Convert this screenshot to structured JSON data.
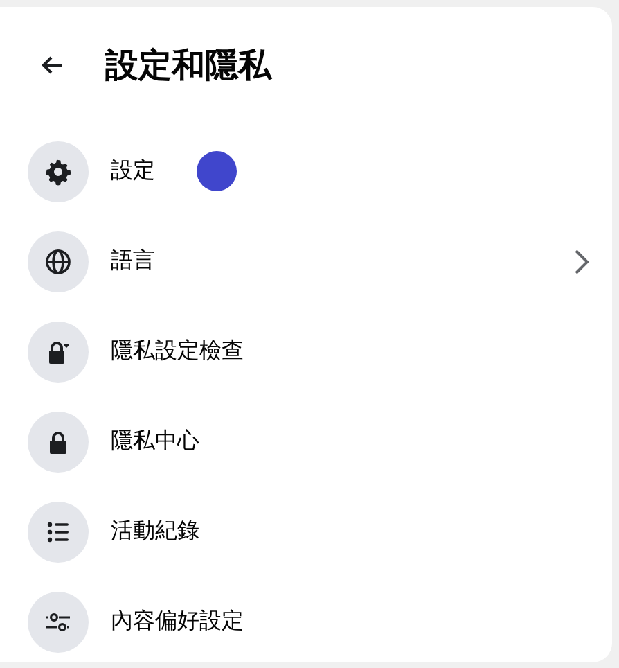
{
  "title": "設定和隱私",
  "items": [
    {
      "label": "設定",
      "submenu": false,
      "pointer": true
    },
    {
      "label": "語言",
      "submenu": true,
      "pointer": false
    },
    {
      "label": "隱私設定檢查",
      "submenu": false,
      "pointer": false
    },
    {
      "label": "隱私中心",
      "submenu": false,
      "pointer": false
    },
    {
      "label": "活動紀錄",
      "submenu": false,
      "pointer": false
    },
    {
      "label": "內容偏好設定",
      "submenu": false,
      "pointer": false
    }
  ]
}
